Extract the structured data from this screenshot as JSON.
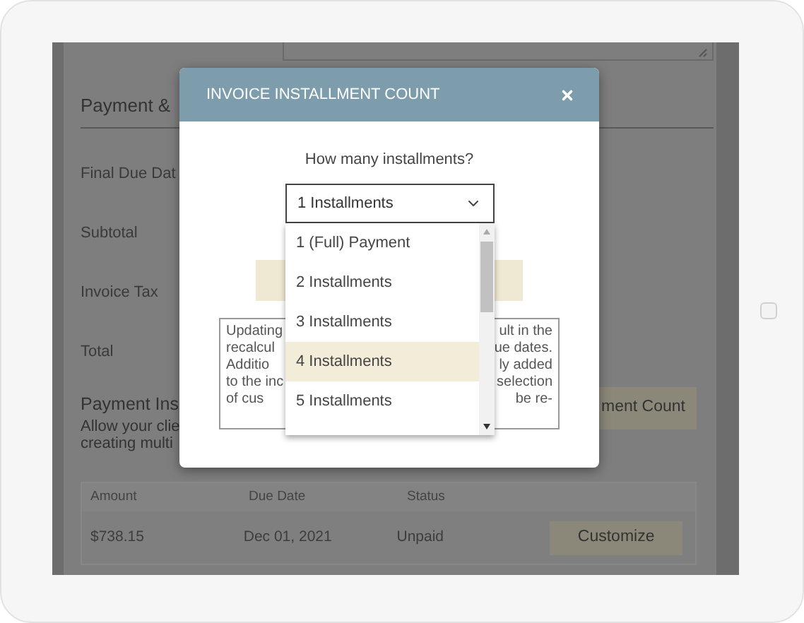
{
  "background_page": {
    "section_heading": "Payment &",
    "fields": [
      "Final Due Dat",
      "Subtotal",
      "Invoice Tax",
      "Total"
    ],
    "installments_heading": "Payment Ins",
    "installments_description": [
      "Allow your clie",
      "creating multi"
    ],
    "count_button": "ment Count",
    "table": {
      "columns": [
        "Amount",
        "Due Date",
        "Status"
      ],
      "rows": [
        {
          "amount": "$738.15",
          "due_date": "Dec 01, 2021",
          "status": "Unpaid",
          "action": "Customize"
        }
      ]
    }
  },
  "dialog": {
    "title": "INVOICE INSTALLMENT COUNT",
    "question": "How many installments?",
    "select": {
      "value": "1 Installments",
      "expanded": true,
      "options": [
        {
          "label": "1 (Full) Payment",
          "selected": false
        },
        {
          "label": "2 Installments",
          "selected": false
        },
        {
          "label": "3 Installments",
          "selected": false
        },
        {
          "label": "4 Installments",
          "selected": true
        },
        {
          "label": "5 Installments",
          "selected": false
        }
      ]
    },
    "note_lines": [
      {
        "left": "Updating",
        "right": "ult in the"
      },
      {
        "left": "recalcul",
        "right": "ue dates."
      },
      {
        "left": "Additio",
        "right": "ly added"
      },
      {
        "left": "to the inc",
        "right": "selection"
      },
      {
        "left": "of cus",
        "right": "be re-"
      }
    ]
  }
}
